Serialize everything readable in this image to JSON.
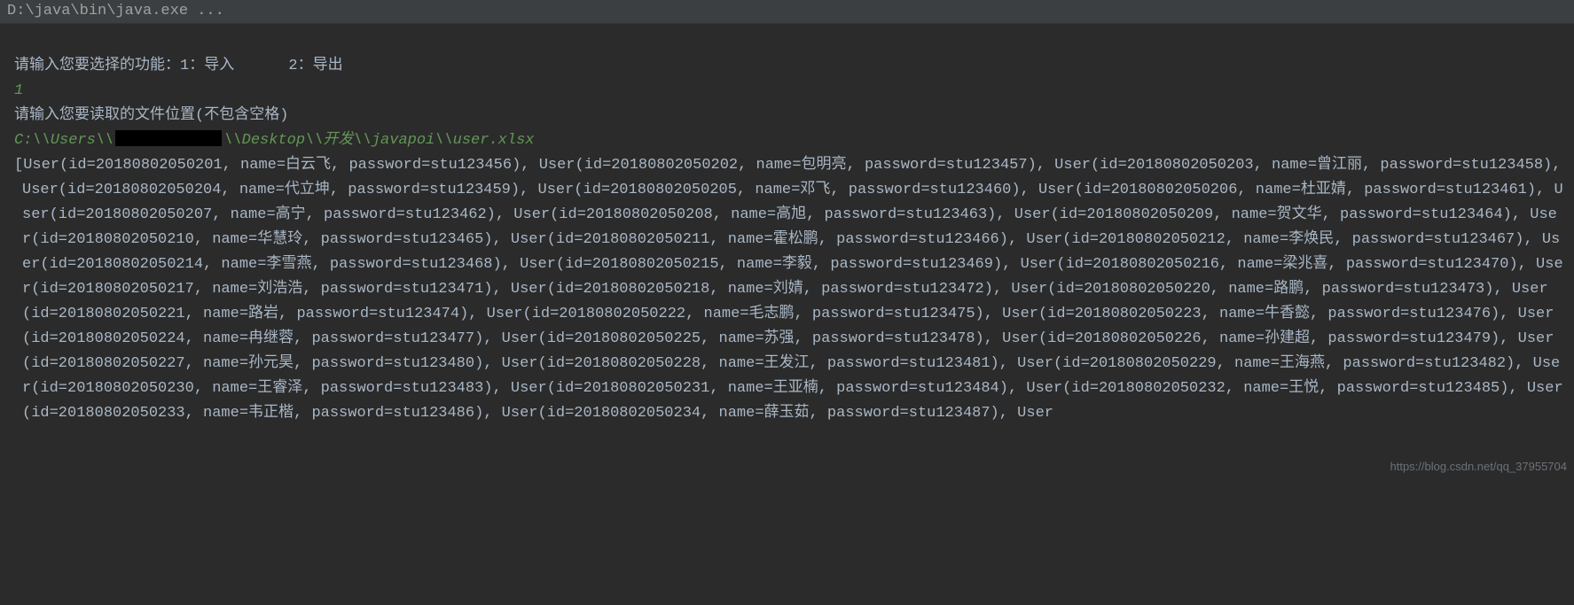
{
  "header": {
    "title": "D:\\java\\bin\\java.exe ..."
  },
  "prompts": {
    "select_function": "请输入您要选择的功能：",
    "opt1": "1：导入",
    "opt2": "2：导出",
    "choice": "1",
    "file_prompt": "请输入您要读取的文件位置(不包含空格)",
    "path_prefix": "C:\\\\Users\\\\",
    "path_suffix": "\\\\Desktop\\\\开发\\\\javapoi\\\\user.xlsx"
  },
  "users": [
    {
      "id": "20180802050201",
      "name": "白云飞",
      "password": "stu123456"
    },
    {
      "id": "20180802050202",
      "name": "包明亮",
      "password": "stu123457"
    },
    {
      "id": "20180802050203",
      "name": "曾江丽",
      "password": "stu123458"
    },
    {
      "id": "20180802050204",
      "name": "代立坤",
      "password": "stu123459"
    },
    {
      "id": "20180802050205",
      "name": "邓飞",
      "password": "stu123460"
    },
    {
      "id": "20180802050206",
      "name": "杜亚婧",
      "password": "stu123461"
    },
    {
      "id": "20180802050207",
      "name": "高宁",
      "password": "stu123462"
    },
    {
      "id": "20180802050208",
      "name": "高旭",
      "password": "stu123463"
    },
    {
      "id": "20180802050209",
      "name": "贺文华",
      "password": "stu123464"
    },
    {
      "id": "20180802050210",
      "name": "华慧玲",
      "password": "stu123465"
    },
    {
      "id": "20180802050211",
      "name": "霍松鹏",
      "password": "stu123466"
    },
    {
      "id": "20180802050212",
      "name": "李焕民",
      "password": "stu123467"
    },
    {
      "id": "20180802050214",
      "name": "李雪燕",
      "password": "stu123468"
    },
    {
      "id": "20180802050215",
      "name": "李毅",
      "password": "stu123469"
    },
    {
      "id": "20180802050216",
      "name": "梁兆喜",
      "password": "stu123470"
    },
    {
      "id": "20180802050217",
      "name": "刘浩浩",
      "password": "stu123471"
    },
    {
      "id": "20180802050218",
      "name": "刘婧",
      "password": "stu123472"
    },
    {
      "id": "20180802050220",
      "name": "路鹏",
      "password": "stu123473"
    },
    {
      "id": "20180802050221",
      "name": "路岩",
      "password": "stu123474"
    },
    {
      "id": "20180802050222",
      "name": "毛志鹏",
      "password": "stu123475"
    },
    {
      "id": "20180802050223",
      "name": "牛香懿",
      "password": "stu123476"
    },
    {
      "id": "20180802050224",
      "name": "冉继蓉",
      "password": "stu123477"
    },
    {
      "id": "20180802050225",
      "name": "苏强",
      "password": "stu123478"
    },
    {
      "id": "20180802050226",
      "name": "孙建超",
      "password": "stu123479"
    },
    {
      "id": "20180802050227",
      "name": "孙元昊",
      "password": "stu123480"
    },
    {
      "id": "20180802050228",
      "name": "王发江",
      "password": "stu123481"
    },
    {
      "id": "20180802050229",
      "name": "王海燕",
      "password": "stu123482"
    },
    {
      "id": "20180802050230",
      "name": "王睿泽",
      "password": "stu123483"
    },
    {
      "id": "20180802050231",
      "name": "王亚楠",
      "password": "stu123484"
    },
    {
      "id": "20180802050232",
      "name": "王悦",
      "password": "stu123485"
    },
    {
      "id": "20180802050233",
      "name": "韦正楷",
      "password": "stu123486"
    },
    {
      "id": "20180802050234",
      "name": "薛玉茹",
      "password": "stu123487"
    }
  ],
  "watermark": "https://blog.csdn.net/qq_37955704"
}
